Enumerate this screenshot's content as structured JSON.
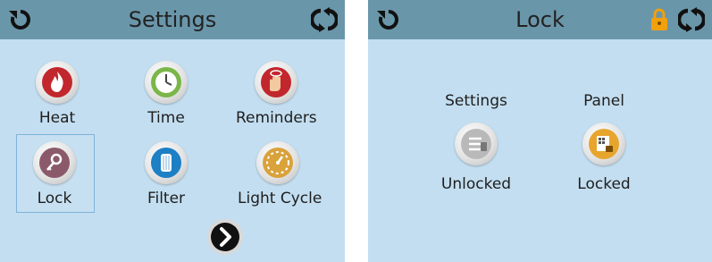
{
  "settings_screen": {
    "title": "Settings",
    "tiles": [
      {
        "label": "Heat",
        "icon": "flame-icon"
      },
      {
        "label": "Time",
        "icon": "clock-icon"
      },
      {
        "label": "Reminders",
        "icon": "hand-reminder-icon"
      },
      {
        "label": "Lock",
        "icon": "key-icon"
      },
      {
        "label": "Filter",
        "icon": "filter-icon"
      },
      {
        "label": "Light Cycle",
        "icon": "light-cycle-icon"
      }
    ],
    "selected": "Lock"
  },
  "lock_screen": {
    "title": "Lock",
    "items": [
      {
        "heading": "Settings",
        "status": "Unlocked",
        "icon": "settings-list-icon"
      },
      {
        "heading": "Panel",
        "status": "Locked",
        "icon": "panel-lock-icon"
      }
    ]
  },
  "colors": {
    "screen_bg": "#c3def0",
    "header_bg": "#6a96aa",
    "accent_lock": "#f1a00e"
  }
}
